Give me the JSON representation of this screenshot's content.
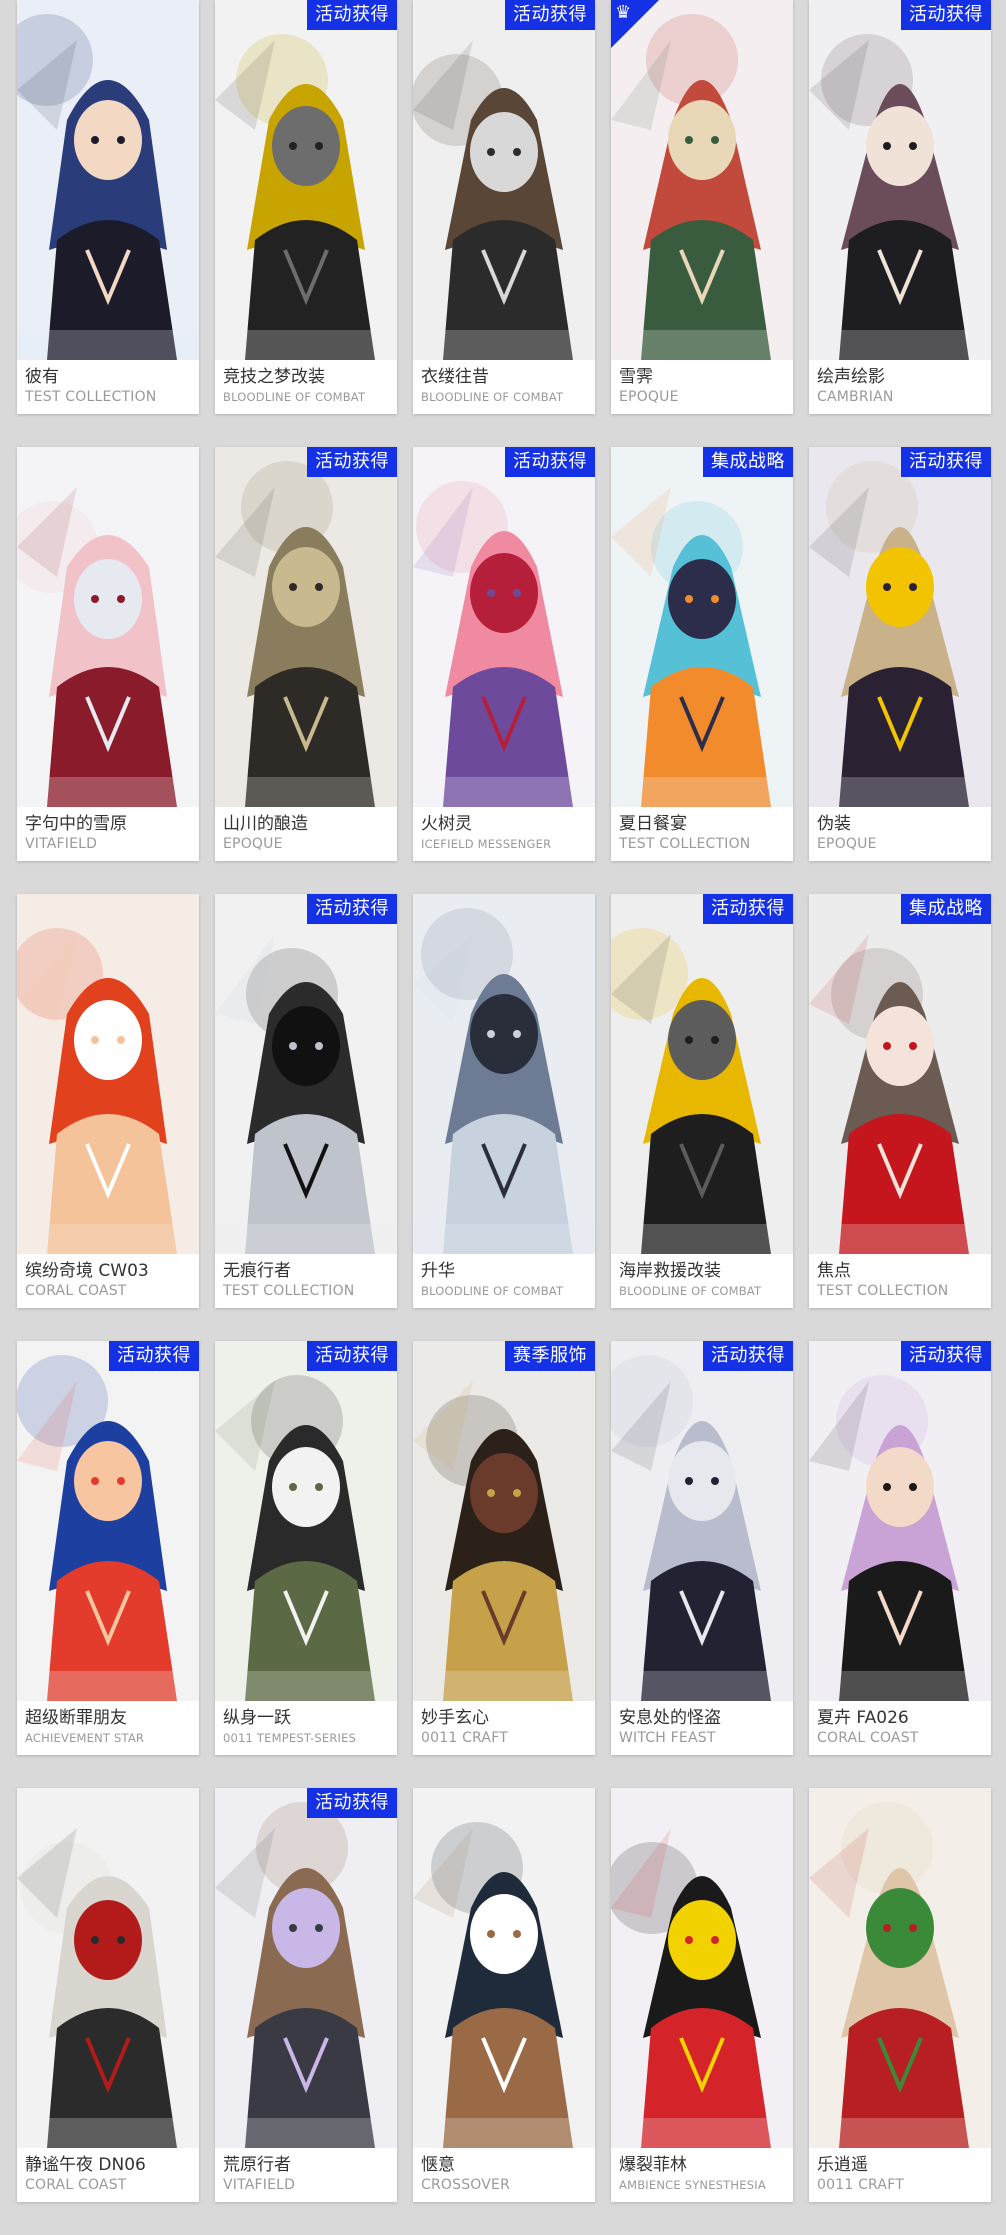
{
  "colors": {
    "background": "#d9d9d9",
    "badge": "#1431e6",
    "card": "#ffffff",
    "name_text": "#333333",
    "series_text": "#9a9a9a"
  },
  "cards": [
    {
      "name": "彼有",
      "series": "TEST COLLECTION",
      "badge": "",
      "corner": false
    },
    {
      "name": "竞技之梦改装",
      "series": "BLOODLINE OF COMBAT",
      "badge": "活动获得",
      "corner": false
    },
    {
      "name": "衣缕往昔",
      "series": "BLOODLINE OF COMBAT",
      "badge": "活动获得",
      "corner": false
    },
    {
      "name": "雪霁",
      "series": "EPOQUE",
      "badge": "",
      "corner": true
    },
    {
      "name": "绘声绘影",
      "series": "CAMBRIAN",
      "badge": "活动获得",
      "corner": false
    },
    {
      "name": "字句中的雪原",
      "series": "VITAFIELD",
      "badge": "",
      "corner": false
    },
    {
      "name": "山川的酿造",
      "series": "EPOQUE",
      "badge": "活动获得",
      "corner": false
    },
    {
      "name": "火树灵",
      "series": "ICEFIELD MESSENGER",
      "badge": "活动获得",
      "corner": false
    },
    {
      "name": "夏日餐宴",
      "series": "TEST COLLECTION",
      "badge": "集成战略",
      "corner": false
    },
    {
      "name": "伪装",
      "series": "EPOQUE",
      "badge": "活动获得",
      "corner": false
    },
    {
      "name": "缤纷奇境 CW03",
      "series": "CORAL COAST",
      "badge": "",
      "corner": false
    },
    {
      "name": "无痕行者",
      "series": "TEST COLLECTION",
      "badge": "活动获得",
      "corner": false
    },
    {
      "name": "升华",
      "series": "BLOODLINE OF COMBAT",
      "badge": "",
      "corner": false
    },
    {
      "name": "海岸救援改装",
      "series": "BLOODLINE OF COMBAT",
      "badge": "活动获得",
      "corner": false
    },
    {
      "name": "焦点",
      "series": "TEST COLLECTION",
      "badge": "集成战略",
      "corner": false
    },
    {
      "name": "超级断罪朋友",
      "series": "ACHIEVEMENT STAR",
      "badge": "活动获得",
      "corner": false
    },
    {
      "name": "纵身一跃",
      "series": "0011 TEMPEST-SERIES",
      "badge": "活动获得",
      "corner": false
    },
    {
      "name": "妙手玄心",
      "series": "0011 CRAFT",
      "badge": "赛季服饰",
      "corner": false
    },
    {
      "name": "安息处的怪盗",
      "series": "WITCH FEAST",
      "badge": "活动获得",
      "corner": false
    },
    {
      "name": "夏卉 FA026",
      "series": "CORAL COAST",
      "badge": "活动获得",
      "corner": false
    },
    {
      "name": "静谧午夜 DN06",
      "series": "CORAL COAST",
      "badge": "",
      "corner": false
    },
    {
      "name": "荒原行者",
      "series": "VITAFIELD",
      "badge": "活动获得",
      "corner": false
    },
    {
      "name": "惬意",
      "series": "CROSSOVER",
      "badge": "",
      "corner": false
    },
    {
      "name": "爆裂菲林",
      "series": "AMBIENCE SYNESTHESIA",
      "badge": "",
      "corner": false
    },
    {
      "name": "乐逍遥",
      "series": "0011 CRAFT",
      "badge": "",
      "corner": false
    }
  ]
}
